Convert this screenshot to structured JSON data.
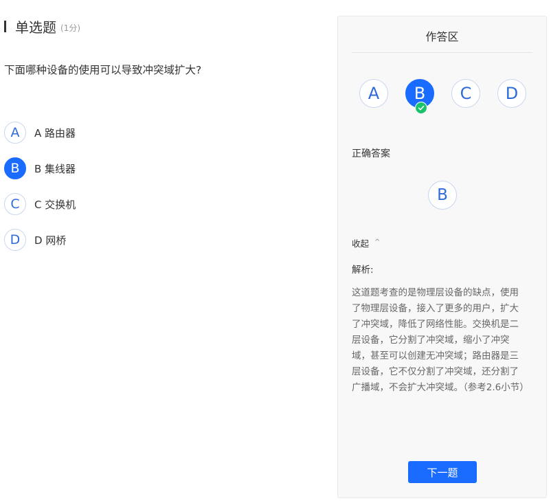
{
  "question": {
    "type_label": "单选题",
    "score": "(1分)",
    "stem": "下面哪种设备的使用可以导致冲突域扩大?",
    "options": [
      {
        "letter": "A",
        "text": "A  路由器"
      },
      {
        "letter": "B",
        "text": "B 集线器"
      },
      {
        "letter": "C",
        "text": "C 交换机"
      },
      {
        "letter": "D",
        "text": "D 网桥"
      }
    ],
    "selected": "B"
  },
  "panel": {
    "title": "作答区",
    "answer_choices": [
      "A",
      "B",
      "C",
      "D"
    ],
    "selected_answer": "B",
    "correct_label": "正确答案",
    "correct_answer": "B",
    "collapse_label": "收起",
    "analysis_label": "解析:",
    "analysis_text": "这道题考查的是物理层设备的缺点，使用了物理层设备，接入了更多的用户，扩大了冲突域，降低了网络性能。交换机是二层设备，它分割了冲突域，缩小了冲突域，甚至可以创建无冲突域；路由器是三层设备，它不仅分割了冲突域，还分割了广播域，不会扩大冲突域。（参考2.6小节）",
    "next_button": "下一题"
  },
  "colors": {
    "accent": "#1a6bff",
    "check_green": "#19c26b",
    "option_letter": "#2f6bd8"
  }
}
